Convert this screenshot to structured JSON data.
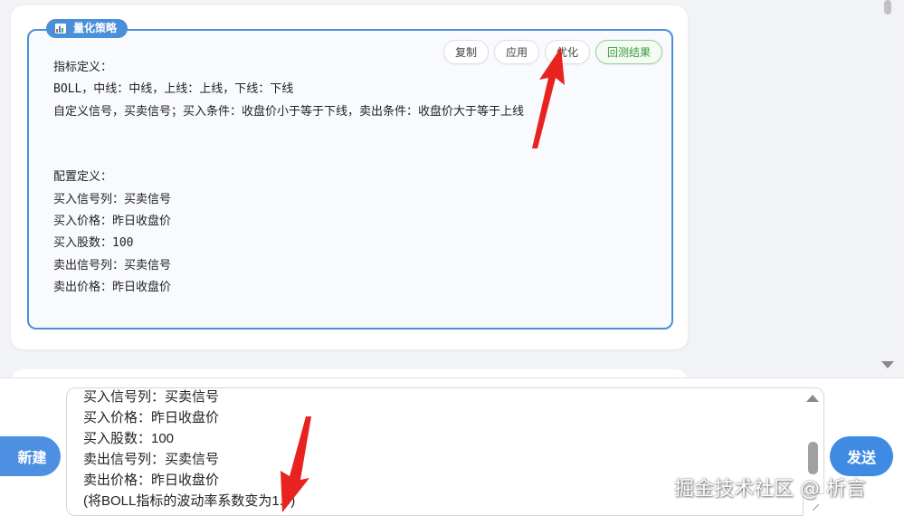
{
  "strategy_card": {
    "tag_label": "量化策略",
    "buttons": {
      "copy": "复制",
      "apply": "应用",
      "optimize": "优化",
      "backtest": "回测结果"
    },
    "lines": [
      "指标定义：",
      "BOLL，中线：中线，上线：上线，下线：下线",
      "自定义信号，买卖信号；买入条件：收盘价小于等于下线，卖出条件：收盘价大于等于上线",
      "",
      "",
      "配置定义：",
      "买入信号列：买卖信号",
      "买入价格：昨日收盘价",
      "买入股数：100",
      "卖出信号列：买卖信号",
      "卖出价格：昨日收盘价"
    ]
  },
  "input_bar": {
    "new_label": "新建",
    "send_label": "发送",
    "text_lines": [
      "买入信号列：买卖信号",
      "买入价格：昨日收盘价",
      "买入股数：100",
      "卖出信号列：买卖信号",
      "卖出价格：昨日收盘价",
      "(将BOLL指标的波动率系数变为1.9)"
    ]
  },
  "watermark": "掘金技术社区 @ 析言",
  "colors": {
    "accent_blue": "#4a8fd8",
    "send_blue": "#3f8be4",
    "backtest_green": "#3a9a3a",
    "annotation_red": "#e8231f"
  }
}
